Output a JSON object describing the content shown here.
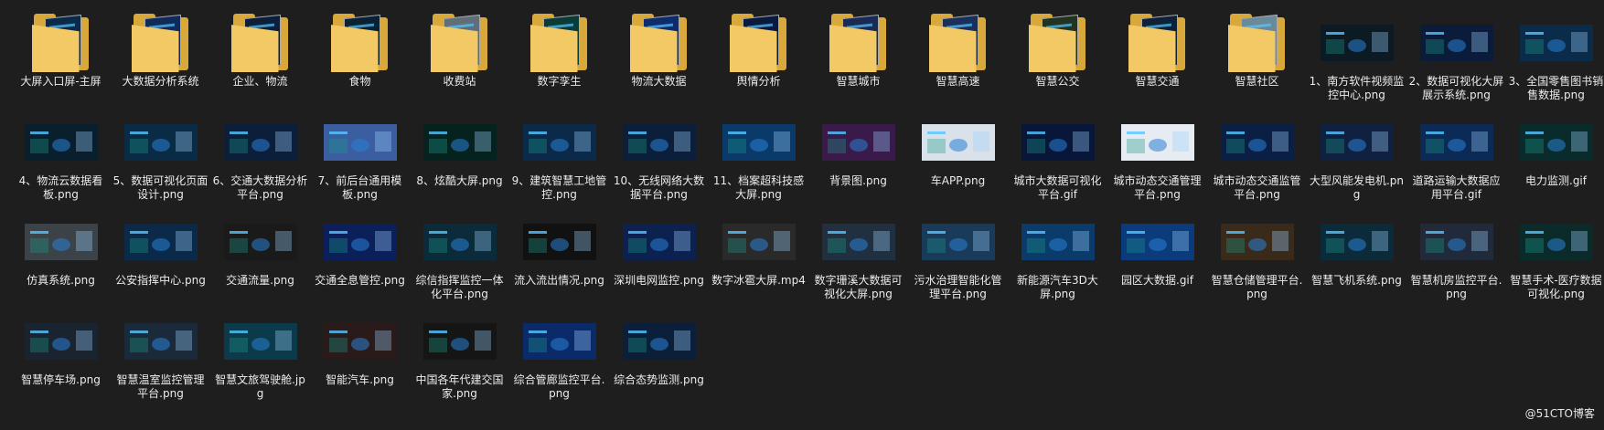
{
  "items": [
    {
      "type": "folder",
      "label": "大屏入口屏-主屏",
      "color": "#0b2a4a"
    },
    {
      "type": "folder",
      "label": "大数据分析系统",
      "color": "#102a5a"
    },
    {
      "type": "folder",
      "label": "企业、物流",
      "color": "#0b1f3a"
    },
    {
      "type": "folder",
      "label": "食物",
      "color": "#0a2033"
    },
    {
      "type": "folder",
      "label": "收费站",
      "color": "#5e6f7a"
    },
    {
      "type": "folder",
      "label": "数字孪生",
      "color": "#0b3b36"
    },
    {
      "type": "folder",
      "label": "物流大数据",
      "color": "#0e2c6b"
    },
    {
      "type": "folder",
      "label": "舆情分析",
      "color": "#0a1a3d"
    },
    {
      "type": "folder",
      "label": "智慧城市",
      "color": "#1a2a55"
    },
    {
      "type": "folder",
      "label": "智慧高速",
      "color": "#1a2f5a"
    },
    {
      "type": "folder",
      "label": "智慧公交",
      "color": "#213321"
    },
    {
      "type": "folder",
      "label": "智慧交通",
      "color": "#0d2137"
    },
    {
      "type": "folder",
      "label": "智慧社区",
      "color": "#6a8a9a"
    },
    {
      "type": "image",
      "label": "1、南方软件视频监控中心.png",
      "color": "#0c1a24"
    },
    {
      "type": "image",
      "label": "2、数据可视化大屏展示系统.png",
      "color": "#0b1c3b"
    },
    {
      "type": "image",
      "label": "3、全国零售图书销售数据.png",
      "color": "#0b2b4b"
    },
    {
      "type": "image",
      "label": "4、物流云数据看板.png",
      "color": "#0a1f2e"
    },
    {
      "type": "image",
      "label": "5、数据可视化页面设计.png",
      "color": "#0a2b45"
    },
    {
      "type": "image",
      "label": "6、交通大数据分析平台.png",
      "color": "#0b1e3a"
    },
    {
      "type": "image",
      "label": "7、前后台通用模板.png",
      "color": "#3a5ea0"
    },
    {
      "type": "image",
      "label": "8、炫酷大屏.png",
      "color": "#06221f"
    },
    {
      "type": "image",
      "label": "9、建筑智慧工地管控.png",
      "color": "#0b2a4a"
    },
    {
      "type": "image",
      "label": "10、无线网络大数据平台.png",
      "color": "#0b1f3a"
    },
    {
      "type": "image",
      "label": "11、档案超科技感大屏.png",
      "color": "#0a3a6a"
    },
    {
      "type": "image",
      "label": "背景图.png",
      "color": "#3a1a4a"
    },
    {
      "type": "image",
      "label": "车APP.png",
      "color": "#d9e2ea"
    },
    {
      "type": "image",
      "label": "城市大数据可视化平台.gif",
      "color": "#08163a"
    },
    {
      "type": "image",
      "label": "城市动态交通管理平台.png",
      "color": "#e6ecf2"
    },
    {
      "type": "image",
      "label": "城市动态交通监管平台.png",
      "color": "#0b1f45"
    },
    {
      "type": "image",
      "label": "大型风能发电机.png",
      "color": "#102040"
    },
    {
      "type": "image",
      "label": "道路运输大数据应用平台.gif",
      "color": "#0b2a55"
    },
    {
      "type": "image",
      "label": "电力监测.gif",
      "color": "#0a2b2b"
    },
    {
      "type": "image",
      "label": "仿真系统.png",
      "color": "#3b4248"
    },
    {
      "type": "image",
      "label": "公安指挥中心.png",
      "color": "#0b2a4a"
    },
    {
      "type": "image",
      "label": "交通流量.png",
      "color": "#1a1a1a"
    },
    {
      "type": "image",
      "label": "交通全息管控.png",
      "color": "#0b1f5a"
    },
    {
      "type": "image",
      "label": "综信指挥监控一体化平台.png",
      "color": "#0b2a3a"
    },
    {
      "type": "image",
      "label": "流入流出情况.png",
      "color": "#111111"
    },
    {
      "type": "image",
      "label": "深圳电网监控.png",
      "color": "#0c2150"
    },
    {
      "type": "image",
      "label": "数字冰雹大屏.mp4",
      "color": "#2a2a2a"
    },
    {
      "type": "image",
      "label": "数字珊溪大数据可视化大屏.png",
      "color": "#203040"
    },
    {
      "type": "image",
      "label": "污水治理智能化管理平台.png",
      "color": "#1a3a5a"
    },
    {
      "type": "image",
      "label": "新能源汽车3D大屏.png",
      "color": "#0b3b6b"
    },
    {
      "type": "image",
      "label": "园区大数据.gif",
      "color": "#0b3b7b"
    },
    {
      "type": "image",
      "label": "智慧仓储管理平台.png",
      "color": "#3a2a1a"
    },
    {
      "type": "image",
      "label": "智慧飞机系统.png",
      "color": "#0b2b3b"
    },
    {
      "type": "image",
      "label": "智慧机房监控平台.png",
      "color": "#202a3a"
    },
    {
      "type": "image",
      "label": "智慧手术-医疗数据可视化.png",
      "color": "#0b2b2b"
    },
    {
      "type": "image",
      "label": "智慧停车场.png",
      "color": "#1a2330"
    },
    {
      "type": "image",
      "label": "智慧温室监控管理平台.png",
      "color": "#1a2a3a"
    },
    {
      "type": "image",
      "label": "智慧文旅驾驶舱.jpg",
      "color": "#0b3b4b"
    },
    {
      "type": "image",
      "label": "智能汽车.png",
      "color": "#2a1a1a"
    },
    {
      "type": "image",
      "label": "中国各年代建交国家.png",
      "color": "#151515"
    },
    {
      "type": "image",
      "label": "综合管廊监控平台.png",
      "color": "#0b2a6a"
    },
    {
      "type": "image",
      "label": "综合态势监测.png",
      "color": "#0b1f3a"
    }
  ],
  "watermark": "@51CTO博客"
}
